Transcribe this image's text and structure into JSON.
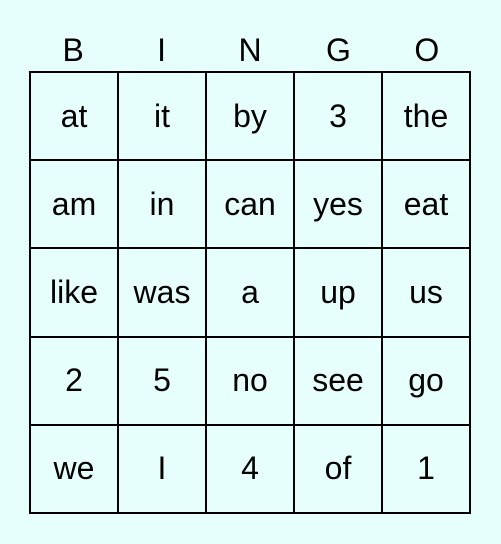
{
  "header": [
    "B",
    "I",
    "N",
    "G",
    "O"
  ],
  "rows": [
    [
      "at",
      "it",
      "by",
      "3",
      "the"
    ],
    [
      "am",
      "in",
      "can",
      "yes",
      "eat"
    ],
    [
      "like",
      "was",
      "a",
      "up",
      "us"
    ],
    [
      "2",
      "5",
      "no",
      "see",
      "go"
    ],
    [
      "we",
      "I",
      "4",
      "of",
      "1"
    ]
  ],
  "colors": {
    "background": "#e6fffc",
    "border": "#000000",
    "text": "#000000"
  }
}
